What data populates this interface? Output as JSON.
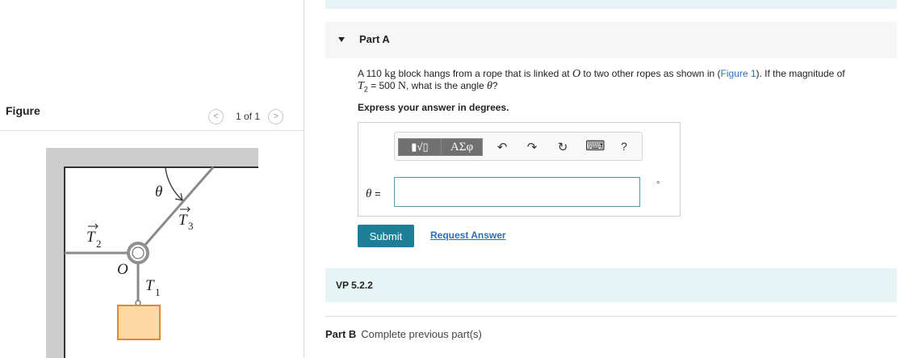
{
  "figure_panel": {
    "title": "Figure",
    "pager_text": "1 of 1",
    "prev_icon": "<",
    "next_icon": ">",
    "diagram": {
      "theta": "θ",
      "T3": "T",
      "T3_sub": "3",
      "T2": "T",
      "T2_sub": "2",
      "T1": "T",
      "T1_sub": "1",
      "O": "O",
      "block_color": "#fcd9a4",
      "ring_color": "#909090"
    }
  },
  "part_a": {
    "title": "Part A",
    "question": {
      "t1": "A 110 ",
      "unit_kg": "kg",
      "t2": " block hangs from a rope that is linked at ",
      "var_O": "O",
      "t3": " to two other ropes as shown in (",
      "figure_link": "Figure 1",
      "t4": "). If the magnitude of",
      "var_T": "T",
      "sub_2": "2",
      "t5": " = 500 ",
      "unit_N": "N",
      "t6": ", what is the angle ",
      "var_theta": "θ",
      "t7": "?"
    },
    "instruction": "Express your answer in degrees.",
    "toolbar": {
      "template_button": "▮√▯",
      "symbols_button": "ΑΣφ",
      "undo_icon": "↶",
      "redo_icon": "↷",
      "reset_icon": "↻",
      "keyboard_icon": "⌨",
      "help_icon": "?"
    },
    "answer_label_var": "θ",
    "answer_label_eq": " =",
    "answer_value": "",
    "unit": "°",
    "submit_label": "Submit",
    "request_label": "Request Answer"
  },
  "vp_label": "VP 5.2.2",
  "part_b": {
    "label": "Part B",
    "status": "Complete previous part(s)"
  },
  "colors": {
    "accent": "#1d7e98",
    "link": "#2f6fb6",
    "band": "#e6f4f5"
  }
}
